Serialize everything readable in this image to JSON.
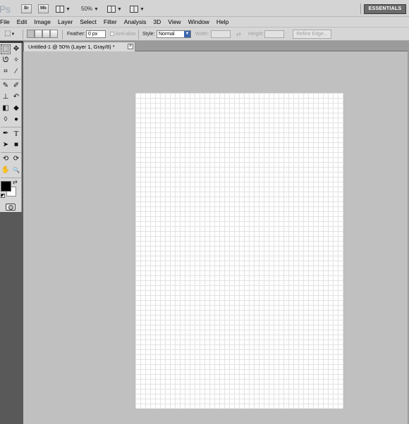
{
  "app": {
    "logo": "Ps",
    "bridge_label": "Br",
    "minibridge_label": "Mb",
    "zoom": "50%",
    "workspace": "ESSENTIALS"
  },
  "menu": [
    "File",
    "Edit",
    "Image",
    "Layer",
    "Select",
    "Filter",
    "Analysis",
    "3D",
    "View",
    "Window",
    "Help"
  ],
  "options": {
    "feather_label": "Feather:",
    "feather_value": "0 px",
    "antialias_label": "Anti-alias",
    "style_label": "Style:",
    "style_value": "Normal",
    "width_label": "Width:",
    "height_label": "Height:",
    "refine_edge": "Refine Edge..."
  },
  "document": {
    "tab_title": "Untitled-1 @ 50% (Layer 1, Gray/8) *",
    "close_glyph": "×"
  },
  "tools": [
    {
      "name": "rectangular-marquee-icon",
      "glyph": "⬚"
    },
    {
      "name": "move-tool-icon",
      "glyph": "✥"
    },
    {
      "name": "lasso-tool-icon",
      "glyph": "ᘎ"
    },
    {
      "name": "magic-wand-icon",
      "glyph": "✧"
    },
    {
      "name": "crop-tool-icon",
      "glyph": "⌗"
    },
    {
      "name": "eyedropper-icon",
      "glyph": "⁄"
    },
    {
      "name": "healing-brush-icon",
      "glyph": "✎"
    },
    {
      "name": "brush-tool-icon",
      "glyph": "✐"
    },
    {
      "name": "clone-stamp-icon",
      "glyph": "⊥"
    },
    {
      "name": "history-brush-icon",
      "glyph": "↶"
    },
    {
      "name": "eraser-tool-icon",
      "glyph": "◧"
    },
    {
      "name": "paint-bucket-icon",
      "glyph": "◆"
    },
    {
      "name": "blur-tool-icon",
      "glyph": "◊"
    },
    {
      "name": "dodge-tool-icon",
      "glyph": "●"
    },
    {
      "name": "pen-tool-icon",
      "glyph": "✒"
    },
    {
      "name": "type-tool-icon",
      "glyph": "T"
    },
    {
      "name": "path-selection-icon",
      "glyph": "➤"
    },
    {
      "name": "rectangle-shape-icon",
      "glyph": "■"
    },
    {
      "name": "3d-rotate-icon",
      "glyph": "⟲"
    },
    {
      "name": "3d-orbit-icon",
      "glyph": "⟳"
    },
    {
      "name": "hand-tool-icon",
      "glyph": "✋"
    },
    {
      "name": "zoom-tool-icon",
      "glyph": "🔍"
    }
  ],
  "colors": {
    "foreground": "#000000",
    "background": "#ffffff",
    "workspace_bg": "#c0c0c0"
  }
}
